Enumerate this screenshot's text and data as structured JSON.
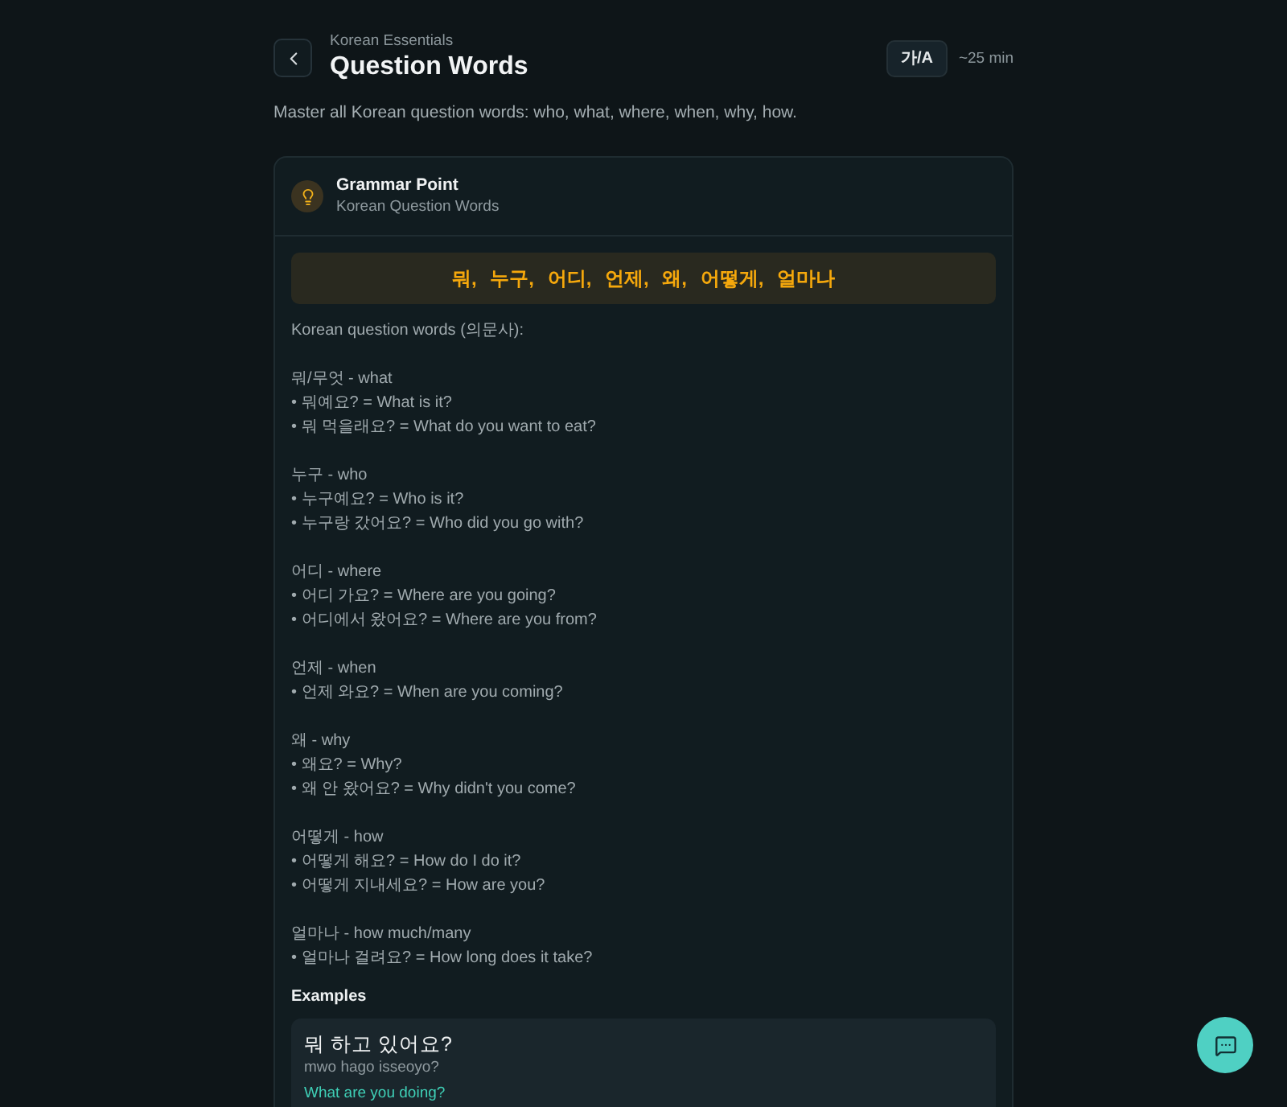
{
  "header": {
    "course": "Korean Essentials",
    "title": "Question Words",
    "language_toggle": "가/A",
    "duration": "~25 min"
  },
  "description": "Master all Korean question words: who, what, where, when, why, how.",
  "grammar_card": {
    "title": "Grammar Point",
    "subtitle": "Korean Question Words",
    "highlight": "뭐, 누구, 어디, 언제, 왜, 어떻게, 얼마나",
    "intro": "Korean question words (의문사):",
    "groups": [
      {
        "heading": "뭐/무엇 - what",
        "lines": [
          "• 뭐예요? = What is it?",
          "• 뭐 먹을래요? = What do you want to eat?"
        ]
      },
      {
        "heading": "누구 - who",
        "lines": [
          "• 누구예요? = Who is it?",
          "• 누구랑 갔어요? = Who did you go with?"
        ]
      },
      {
        "heading": "어디 - where",
        "lines": [
          "• 어디 가요? = Where are you going?",
          "• 어디에서 왔어요? = Where are you from?"
        ]
      },
      {
        "heading": "언제 - when",
        "lines": [
          "• 언제 와요? = When are you coming?"
        ]
      },
      {
        "heading": "왜 - why",
        "lines": [
          "• 왜요? = Why?",
          "• 왜 안 왔어요? = Why didn't you come?"
        ]
      },
      {
        "heading": "어떻게 - how",
        "lines": [
          "• 어떻게 해요? = How do I do it?",
          "• 어떻게 지내세요? = How are you?"
        ]
      },
      {
        "heading": "얼마나 - how much/many",
        "lines": [
          "• 얼마나 걸려요? = How long does it take?"
        ]
      }
    ],
    "examples_heading": "Examples",
    "examples": [
      {
        "korean": "뭐 하고 있어요?",
        "romanization": "mwo hago isseoyo?",
        "translation": "What are you doing?"
      }
    ]
  }
}
